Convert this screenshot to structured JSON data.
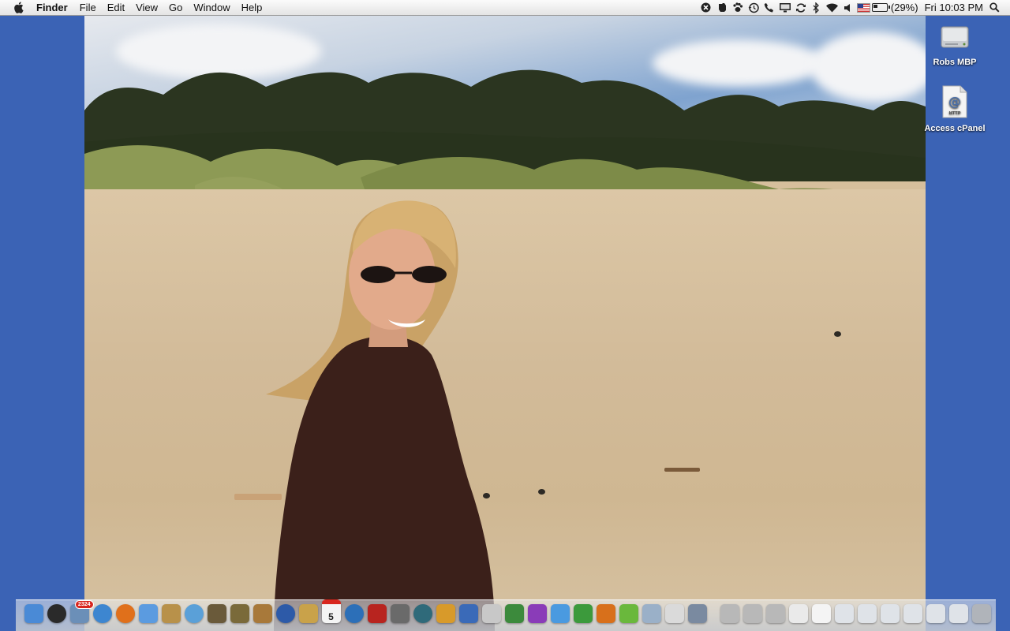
{
  "menubar": {
    "app_name": "Finder",
    "menus": [
      "File",
      "Edit",
      "View",
      "Go",
      "Window",
      "Help"
    ],
    "status": {
      "battery_percent": "(29%)",
      "clock": "Fri 10:03 PM",
      "icons": [
        "crossover-icon",
        "evernote-icon",
        "growl-paw-icon",
        "time-machine-icon",
        "phone-icon",
        "display-icon",
        "sync-icon",
        "bluetooth-icon",
        "wifi-icon",
        "volume-icon",
        "input-flag-icon",
        "battery-icon",
        "spotlight-icon"
      ]
    }
  },
  "desktop": {
    "icons": [
      {
        "label": "Robs MBP",
        "icon": "hard-drive-icon"
      },
      {
        "label": "Access cPanel",
        "icon": "http-webloc-icon"
      }
    ],
    "wallpaper": "beach-photo"
  },
  "dock": {
    "apps": [
      {
        "name": "finder",
        "color": "#4a8ad6"
      },
      {
        "name": "dashboard",
        "color": "#2a2a2a"
      },
      {
        "name": "mail",
        "color": "#6b8fb8",
        "badge": "2324"
      },
      {
        "name": "safari",
        "color": "#3d86d0"
      },
      {
        "name": "firefox",
        "color": "#e0701b"
      },
      {
        "name": "ichat",
        "color": "#5b9be0"
      },
      {
        "name": "address-book",
        "color": "#b8914a"
      },
      {
        "name": "itunes",
        "color": "#5aa0d8"
      },
      {
        "name": "iphoto",
        "color": "#6a5a3a"
      },
      {
        "name": "imovie",
        "color": "#7a6a3a"
      },
      {
        "name": "garageband",
        "color": "#a8793a"
      },
      {
        "name": "dvd-player",
        "color": "#2d5aa8"
      },
      {
        "name": "preview",
        "color": "#c9a24a"
      },
      {
        "name": "ical",
        "color": "#f4f4f4",
        "date": "5"
      },
      {
        "name": "quicktime",
        "color": "#2c6fb8"
      },
      {
        "name": "photo-booth",
        "color": "#b8241f"
      },
      {
        "name": "screen-capture",
        "color": "#6a6a6a"
      },
      {
        "name": "time-machine",
        "color": "#2f6a7a"
      },
      {
        "name": "automator",
        "color": "#d89a2a"
      },
      {
        "name": "keynote",
        "color": "#3a6ab8"
      },
      {
        "name": "textedit",
        "color": "#c8c8c8"
      },
      {
        "name": "numbers",
        "color": "#3c8a3c"
      },
      {
        "name": "omnifocus",
        "color": "#8a3cb8"
      },
      {
        "name": "iweb",
        "color": "#4a9ae0"
      },
      {
        "name": "excel",
        "color": "#3c9a3c"
      },
      {
        "name": "powerpoint",
        "color": "#d8701b"
      },
      {
        "name": "evernote",
        "color": "#6ab83c"
      },
      {
        "name": "finder-2",
        "color": "#9ab0c8"
      },
      {
        "name": "grapher",
        "color": "#dadada"
      },
      {
        "name": "preferences",
        "color": "#7a8aa0"
      }
    ],
    "stacks": [
      {
        "name": "stack-1",
        "color": "#b8b8b8"
      },
      {
        "name": "stack-2",
        "color": "#b8b8b8"
      },
      {
        "name": "stack-3",
        "color": "#b8b8b8"
      },
      {
        "name": "docs-stack",
        "color": "#eaeaea"
      },
      {
        "name": "doc-file",
        "color": "#f4f4f4"
      },
      {
        "name": "window-1",
        "color": "#dfe3e8"
      },
      {
        "name": "window-2",
        "color": "#dfe3e8"
      },
      {
        "name": "window-3",
        "color": "#dfe3e8"
      },
      {
        "name": "window-4",
        "color": "#dfe3e8"
      },
      {
        "name": "window-5",
        "color": "#dfe3e8"
      },
      {
        "name": "window-6",
        "color": "#dfe3e8"
      },
      {
        "name": "trash",
        "color": "#b0b4ba"
      }
    ]
  }
}
